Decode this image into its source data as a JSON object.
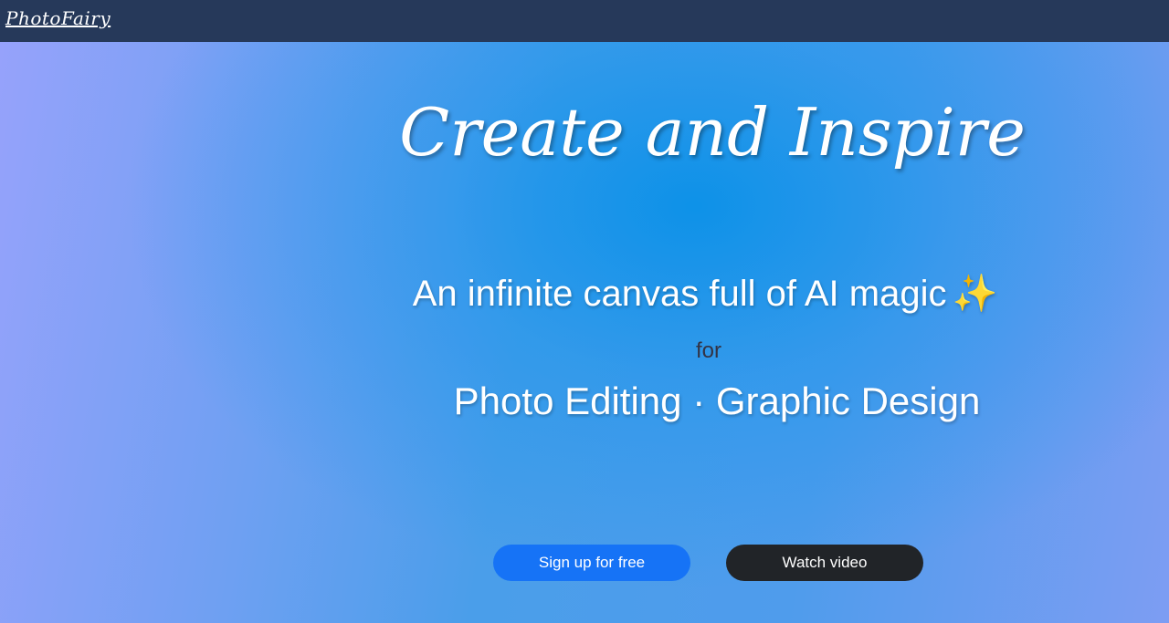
{
  "header": {
    "logo_text": "PhotoFairy"
  },
  "hero": {
    "headline": "Create and Inspire",
    "subhead": "An infinite canvas full of AI magic",
    "sparkle": "✨",
    "connector": "for",
    "categories": "Photo Editing · Graphic Design"
  },
  "actions": {
    "signup_label": "Sign up for free",
    "watch_label": "Watch video"
  },
  "colors": {
    "topbar": "#26395a",
    "signup_button": "#1673f6",
    "watch_button": "#212428"
  }
}
